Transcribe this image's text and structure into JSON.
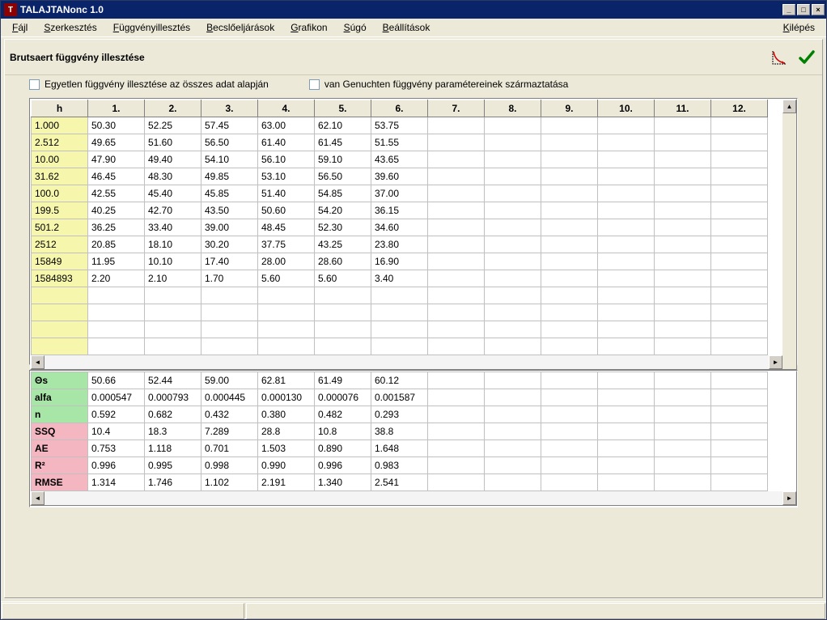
{
  "window": {
    "title": "TALAJTANonc 1.0"
  },
  "menu": {
    "items": [
      "Fájl",
      "Szerkesztés",
      "Függvényillesztés",
      "Becslőeljárások",
      "Grafikon",
      "Súgó",
      "Beállítások"
    ],
    "exit": "Kilépés"
  },
  "panel": {
    "title": "Brutsaert függvény illesztése"
  },
  "checkboxes": {
    "cb1": "Egyetlen függvény illesztése az összes adat alapján",
    "cb2": "van Genuchten  függvény paramétereinek származtatása"
  },
  "grid1": {
    "headers": [
      "h",
      "1.",
      "2.",
      "3.",
      "4.",
      "5.",
      "6.",
      "7.",
      "8.",
      "9.",
      "10.",
      "11.",
      "12."
    ],
    "rows": [
      {
        "h": "1.000",
        "v": [
          "50.30",
          "52.25",
          "57.45",
          "63.00",
          "62.10",
          "53.75",
          "",
          "",
          "",
          "",
          "",
          ""
        ]
      },
      {
        "h": "2.512",
        "v": [
          "49.65",
          "51.60",
          "56.50",
          "61.40",
          "61.45",
          "51.55",
          "",
          "",
          "",
          "",
          "",
          ""
        ]
      },
      {
        "h": "10.00",
        "v": [
          "47.90",
          "49.40",
          "54.10",
          "56.10",
          "59.10",
          "43.65",
          "",
          "",
          "",
          "",
          "",
          ""
        ]
      },
      {
        "h": "31.62",
        "v": [
          "46.45",
          "48.30",
          "49.85",
          "53.10",
          "56.50",
          "39.60",
          "",
          "",
          "",
          "",
          "",
          ""
        ]
      },
      {
        "h": "100.0",
        "v": [
          "42.55",
          "45.40",
          "45.85",
          "51.40",
          "54.85",
          "37.00",
          "",
          "",
          "",
          "",
          "",
          ""
        ]
      },
      {
        "h": "199.5",
        "v": [
          "40.25",
          "42.70",
          "43.50",
          "50.60",
          "54.20",
          "36.15",
          "",
          "",
          "",
          "",
          "",
          ""
        ]
      },
      {
        "h": "501.2",
        "v": [
          "36.25",
          "33.40",
          "39.00",
          "48.45",
          "52.30",
          "34.60",
          "",
          "",
          "",
          "",
          "",
          ""
        ]
      },
      {
        "h": "2512",
        "v": [
          "20.85",
          "18.10",
          "30.20",
          "37.75",
          "43.25",
          "23.80",
          "",
          "",
          "",
          "",
          "",
          ""
        ]
      },
      {
        "h": "15849",
        "v": [
          "11.95",
          "10.10",
          "17.40",
          "28.00",
          "28.60",
          "16.90",
          "",
          "",
          "",
          "",
          "",
          ""
        ]
      },
      {
        "h": "1584893",
        "v": [
          "2.20",
          "2.10",
          "1.70",
          "5.60",
          "5.60",
          "3.40",
          "",
          "",
          "",
          "",
          "",
          ""
        ]
      },
      {
        "h": "",
        "v": [
          "",
          "",
          "",
          "",
          "",
          "",
          "",
          "",
          "",
          "",
          "",
          ""
        ]
      },
      {
        "h": "",
        "v": [
          "",
          "",
          "",
          "",
          "",
          "",
          "",
          "",
          "",
          "",
          "",
          ""
        ]
      },
      {
        "h": "",
        "v": [
          "",
          "",
          "",
          "",
          "",
          "",
          "",
          "",
          "",
          "",
          "",
          ""
        ]
      },
      {
        "h": "",
        "v": [
          "",
          "",
          "",
          "",
          "",
          "",
          "",
          "",
          "",
          "",
          "",
          ""
        ]
      }
    ]
  },
  "grid2": {
    "rows": [
      {
        "label": "Θs",
        "cls": "green",
        "v": [
          "50.66",
          "52.44",
          "59.00",
          "62.81",
          "61.49",
          "60.12",
          "",
          "",
          "",
          "",
          "",
          ""
        ]
      },
      {
        "label": "alfa",
        "cls": "green",
        "v": [
          "0.000547",
          "0.000793",
          "0.000445",
          "0.000130",
          "0.000076",
          "0.001587",
          "",
          "",
          "",
          "",
          "",
          ""
        ]
      },
      {
        "label": "n",
        "cls": "green",
        "v": [
          "0.592",
          "0.682",
          "0.432",
          "0.380",
          "0.482",
          "0.293",
          "",
          "",
          "",
          "",
          "",
          ""
        ]
      },
      {
        "label": "SSQ",
        "cls": "pink",
        "v": [
          "10.4",
          "18.3",
          "7.289",
          "28.8",
          "10.8",
          "38.8",
          "",
          "",
          "",
          "",
          "",
          ""
        ]
      },
      {
        "label": "AE",
        "cls": "pink",
        "v": [
          "0.753",
          "1.118",
          "0.701",
          "1.503",
          "0.890",
          "1.648",
          "",
          "",
          "",
          "",
          "",
          ""
        ]
      },
      {
        "label": "R²",
        "cls": "pink",
        "v": [
          "0.996",
          "0.995",
          "0.998",
          "0.990",
          "0.996",
          "0.983",
          "",
          "",
          "",
          "",
          "",
          ""
        ]
      },
      {
        "label": "RMSE",
        "cls": "pink",
        "v": [
          "1.314",
          "1.746",
          "1.102",
          "2.191",
          "1.340",
          "2.541",
          "",
          "",
          "",
          "",
          "",
          ""
        ]
      }
    ]
  }
}
